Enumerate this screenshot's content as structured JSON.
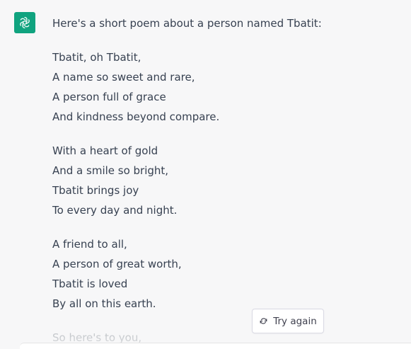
{
  "message": {
    "intro": "Here's a short poem about a person named Tbatit:",
    "stanzas": [
      [
        "Tbatit, oh Tbatit,",
        "A name so sweet and rare,",
        "A person full of grace",
        "And kindness beyond compare."
      ],
      [
        "With a heart of gold",
        "And a smile so bright,",
        "Tbatit brings joy",
        "To every day and night."
      ],
      [
        "A friend to all,",
        "A person of great worth,",
        "Tbatit is loved",
        "By all on this earth."
      ]
    ],
    "partial_line": "So here's to you,"
  },
  "actions": {
    "try_again_label": "Try again",
    "try_again_icon": "refresh-icon"
  },
  "colors": {
    "background": "#f7f7f8",
    "avatar": "#10a37f",
    "text": "#374151"
  },
  "avatar": {
    "icon": "openai-logo-icon"
  }
}
